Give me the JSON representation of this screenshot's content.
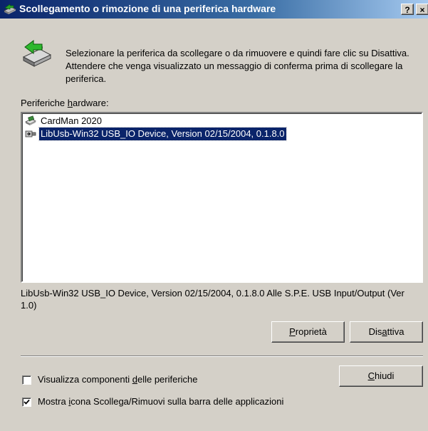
{
  "window": {
    "title": "Scollegamento o rimozione di una periferica hardware",
    "help_button": "?",
    "close_button": "×"
  },
  "instructions": "Selezionare la periferica da scollegare o da rimuovere e quindi fare clic su Disattiva. Attendere che venga visualizzato un messaggio di conferma prima di scollegare la periferica.",
  "devices_label": {
    "before": "Periferiche ",
    "accel": "h",
    "after": "ardware:"
  },
  "devices": [
    {
      "label": "CardMan 2020",
      "icon": "card-reader-icon",
      "selected": false
    },
    {
      "label": "LibUsb-Win32 USB_IO Device, Version 02/15/2004, 0.1.8.0",
      "icon": "usb-icon",
      "selected": true
    }
  ],
  "selected_description": "LibUsb-Win32 USB_IO Device, Version 02/15/2004, 0.1.8.0 Alle S.P.E. USB Input/Output (Ver 1.0)",
  "buttons": {
    "properties": {
      "before": "",
      "accel": "P",
      "after": "roprietà"
    },
    "deactivate": {
      "before": "Dis",
      "accel": "a",
      "after": "ttiva"
    },
    "close": {
      "before": "",
      "accel": "C",
      "after": "hiudi"
    }
  },
  "options": [
    {
      "before": "Visualizza componenti ",
      "accel": "d",
      "after": "elle periferiche",
      "checked": false
    },
    {
      "before": "Mostra ",
      "accel": "i",
      "after": "cona Scollega/Rimuovi sulla barra delle applicazioni",
      "checked": true
    }
  ],
  "colors": {
    "titlebar_start": "#0a246a",
    "titlebar_end": "#a6caf0",
    "selection": "#0a246a",
    "face": "#d4d0c8"
  }
}
